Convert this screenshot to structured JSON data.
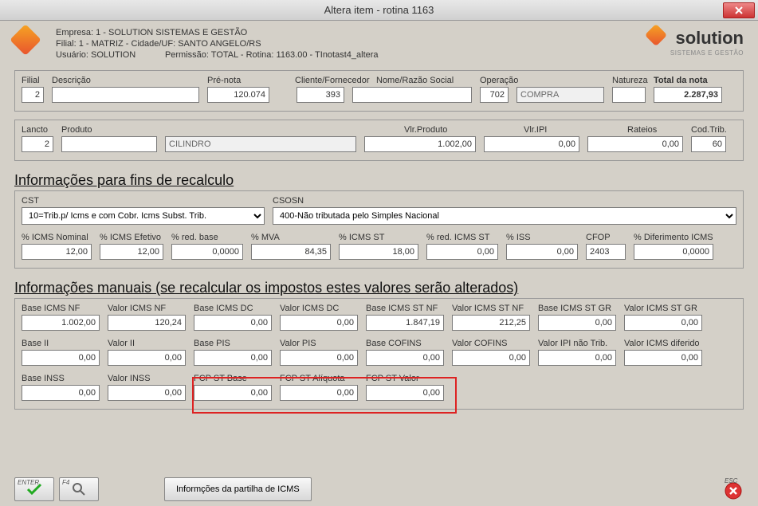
{
  "window": {
    "title": "Altera item - rotina 1163"
  },
  "company": {
    "empresa": "Empresa: 1 - SOLUTION SISTEMAS E GESTÃO",
    "filial": "Filial: 1 - MATRIZ - Cidade/UF: SANTO ANGELO/RS",
    "usuario": "Usuário: SOLUTION",
    "permissao": "Permissão: TOTAL - Rotina: 1163.00 - TInotast4_altera"
  },
  "brand": {
    "name": "solution",
    "tagline": "SISTEMAS E GESTÃO"
  },
  "top1": {
    "filial_label": "Filial",
    "filial": "2",
    "descricao_label": "Descrição",
    "descricao": "",
    "prenota_label": "Pré-nota",
    "prenota": "120.074",
    "cliente_label": "Cliente/Fornecedor",
    "cliente": "393",
    "nome_label": "Nome/Razão Social",
    "nome": "",
    "operacao_label": "Operação",
    "operacao": "702",
    "operacao_nome": "COMPRA",
    "natureza_label": "Natureza",
    "natureza": "",
    "total_label": "Total da nota",
    "total": "2.287,93"
  },
  "top2": {
    "lancto_label": "Lancto",
    "lancto": "2",
    "produto_label": "Produto",
    "produto_cod": "",
    "produto_desc": "CILINDRO",
    "vlr_produto_label": "Vlr.Produto",
    "vlr_produto": "1.002,00",
    "vlr_ipi_label": "Vlr.IPI",
    "vlr_ipi": "0,00",
    "rateios_label": "Rateios",
    "rateios": "0,00",
    "cod_trib_label": "Cod.Trib.",
    "cod_trib": "60"
  },
  "sec1_title": "Informações para fins de recalculo",
  "recalc": {
    "cst_label": "CST",
    "cst": "10=Trib.p/ Icms e com Cobr. Icms Subst. Trib.",
    "csosn_label": "CSOSN",
    "csosn": "400-Não tributada pelo Simples Nacional",
    "icms_nominal_label": "% ICMS Nominal",
    "icms_nominal": "12,00",
    "icms_efetivo_label": "% ICMS Efetivo",
    "icms_efetivo": "12,00",
    "red_base_label": "% red. base",
    "red_base": "0,0000",
    "mva_label": "% MVA",
    "mva": "84,35",
    "icms_st_label": "% ICMS ST",
    "icms_st": "18,00",
    "red_icms_st_label": "% red. ICMS ST",
    "red_icms_st": "0,00",
    "iss_label": "% ISS",
    "iss": "0,00",
    "cfop_label": "CFOP",
    "cfop": "2403",
    "dif_icms_label": "% Diferimento ICMS",
    "dif_icms": "0,0000"
  },
  "sec2_title": "Informações manuais (se recalcular os impostos estes valores serão alterados)",
  "manual": {
    "base_icms_nf_label": "Base ICMS NF",
    "base_icms_nf": "1.002,00",
    "valor_icms_nf_label": "Valor ICMS NF",
    "valor_icms_nf": "120,24",
    "base_icms_dc_label": "Base ICMS DC",
    "base_icms_dc": "0,00",
    "valor_icms_dc_label": "Valor ICMS DC",
    "valor_icms_dc": "0,00",
    "base_icms_st_nf_label": "Base ICMS ST NF",
    "base_icms_st_nf": "1.847,19",
    "valor_icms_st_nf_label": "Valor ICMS ST NF",
    "valor_icms_st_nf": "212,25",
    "base_icms_st_gr_label": "Base ICMS ST GR",
    "base_icms_st_gr": "0,00",
    "valor_icms_st_gr_label": "Valor ICMS ST GR",
    "valor_icms_st_gr": "0,00",
    "base_ii_label": "Base II",
    "base_ii": "0,00",
    "valor_ii_label": "Valor II",
    "valor_ii": "0,00",
    "base_pis_label": "Base PIS",
    "base_pis": "0,00",
    "valor_pis_label": "Valor PIS",
    "valor_pis": "0,00",
    "base_cofins_label": "Base COFINS",
    "base_cofins": "0,00",
    "valor_cofins_label": "Valor COFINS",
    "valor_cofins": "0,00",
    "valor_ipi_nao_trib_label": "Valor IPI não Trib.",
    "valor_ipi_nao_trib": "0,00",
    "valor_icms_diferido_label": "Valor ICMS diferido",
    "valor_icms_diferido": "0,00",
    "base_inss_label": "Base INSS",
    "base_inss": "0,00",
    "valor_inss_label": "Valor INSS",
    "valor_inss": "0,00",
    "fcp_st_base_label": "FCP ST Base",
    "fcp_st_base": "0,00",
    "fcp_st_aliq_label": "FCP ST Alíquota",
    "fcp_st_aliq": "0,00",
    "fcp_st_valor_label": "FCP ST Valor",
    "fcp_st_valor": "0,00"
  },
  "buttons": {
    "enter_key": "ENTER",
    "f4_key": "F4",
    "partilha": "Informções da partilha de ICMS",
    "esc_key": "ESC"
  }
}
